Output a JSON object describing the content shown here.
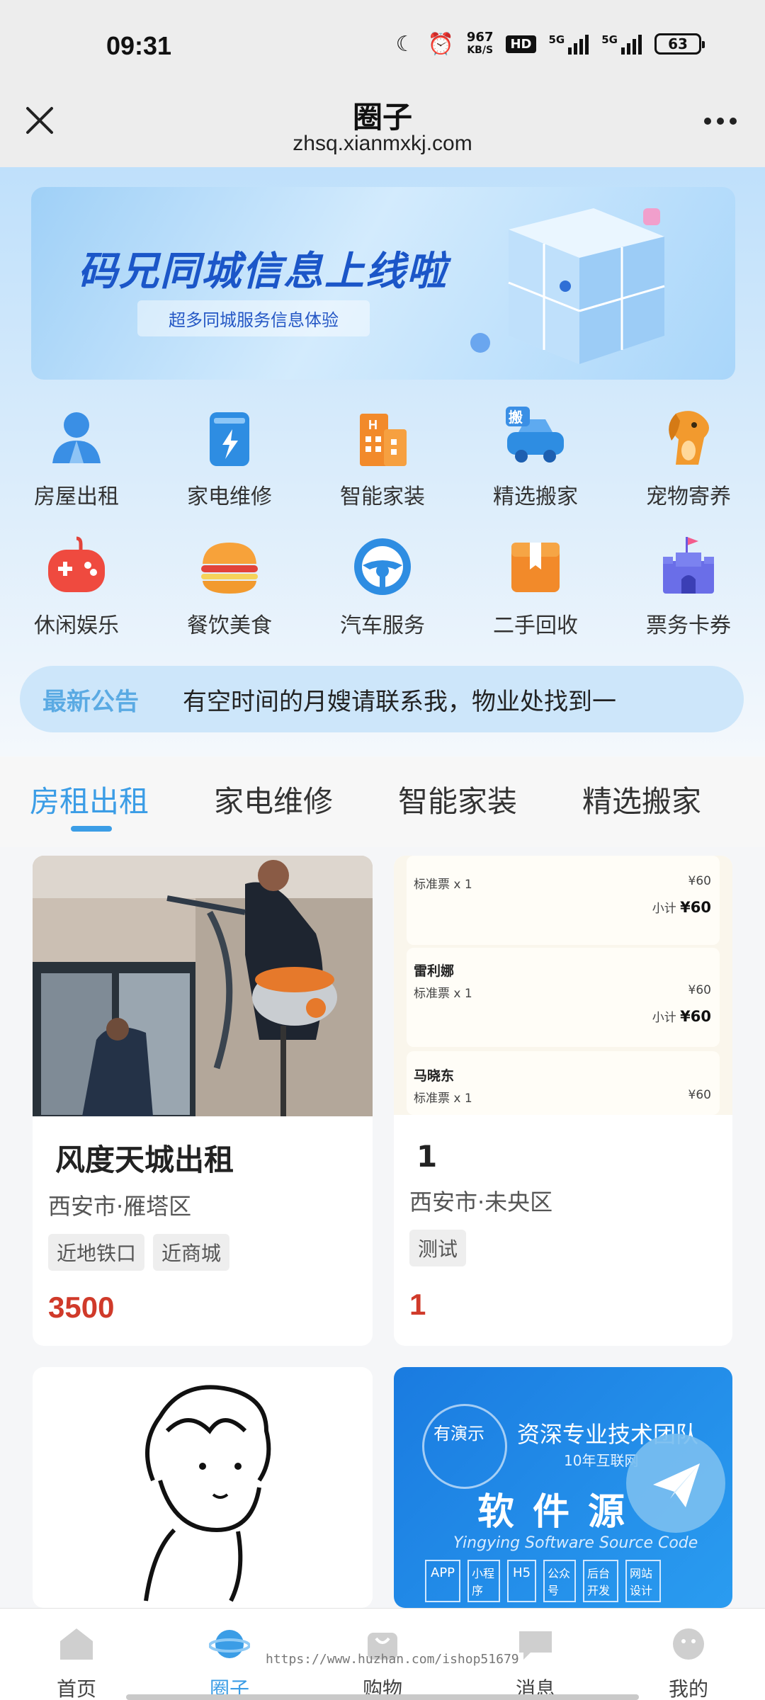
{
  "status_bar": {
    "time": "09:31",
    "speed_value": "967",
    "speed_unit": "KB/S",
    "hd": "HD",
    "signal1": "5G",
    "signal2": "5G",
    "battery": "63"
  },
  "nav": {
    "title": "圈子",
    "url": "zhsq.xianmxkj.com"
  },
  "banner": {
    "title": "码兄同城信息上线啦",
    "subtitle": "超多同城服务信息体验"
  },
  "categories": [
    {
      "label": "房屋出租",
      "icon": "person-house-icon"
    },
    {
      "label": "家电维修",
      "icon": "battery-repair-icon"
    },
    {
      "label": "智能家装",
      "icon": "building-icon"
    },
    {
      "label": "精选搬家",
      "icon": "moving-truck-icon"
    },
    {
      "label": "宠物寄养",
      "icon": "pet-dog-icon"
    },
    {
      "label": "休闲娱乐",
      "icon": "game-controller-icon"
    },
    {
      "label": "餐饮美食",
      "icon": "burger-icon"
    },
    {
      "label": "汽车服务",
      "icon": "steering-wheel-icon"
    },
    {
      "label": "二手回收",
      "icon": "box-icon"
    },
    {
      "label": "票务卡券",
      "icon": "castle-icon"
    }
  ],
  "notice": {
    "tag": "最新公告",
    "text": "有空时间的月嫂请联系我，物业处找到一"
  },
  "tabs": [
    {
      "label": "房租出租",
      "active": true
    },
    {
      "label": "家电维修",
      "active": false
    },
    {
      "label": "智能家装",
      "active": false
    },
    {
      "label": "精选搬家",
      "active": false
    }
  ],
  "cards": [
    {
      "title": "风度天城出租",
      "location": "西安市·雁塔区",
      "tags": [
        "近地铁口",
        "近商城"
      ],
      "price": "3500"
    },
    {
      "title": "1",
      "location": "西安市·未央区",
      "tags": [
        "测试"
      ],
      "price": "1",
      "tickets": [
        {
          "name": "",
          "line": "标准票 x 1",
          "price": "¥60",
          "subtotal_label": "小计",
          "subtotal": "¥60"
        },
        {
          "name": "雷利娜",
          "line": "标准票 x 1",
          "price": "¥60",
          "subtotal_label": "小计",
          "subtotal": "¥60"
        },
        {
          "name": "马晓东",
          "line": "标准票 x 1",
          "price": "¥60",
          "subtotal_label": "",
          "subtotal": ""
        }
      ]
    },
    {
      "title": "",
      "location": "",
      "tags": [],
      "price": ""
    },
    {
      "badge": "有演示",
      "headline": "资深专业技术团队",
      "years": "10年互联网",
      "big_text": "软件源",
      "eng": "Yingying Software Source Code",
      "chips": [
        "APP",
        "小程序",
        "H5",
        "公众号",
        "后台开发",
        "网站设计"
      ]
    }
  ],
  "bottom_nav": [
    {
      "label": "首页",
      "icon": "home-icon",
      "active": false
    },
    {
      "label": "圈子",
      "icon": "planet-icon",
      "active": true
    },
    {
      "label": "购物",
      "icon": "shopping-bag-icon",
      "active": false
    },
    {
      "label": "消息",
      "icon": "message-icon",
      "active": false
    },
    {
      "label": "我的",
      "icon": "profile-icon",
      "active": false
    }
  ],
  "watermark": "https://www.huzhan.com/ishop51679",
  "colors": {
    "accent": "#3b9de6",
    "price": "#d03a2a"
  }
}
